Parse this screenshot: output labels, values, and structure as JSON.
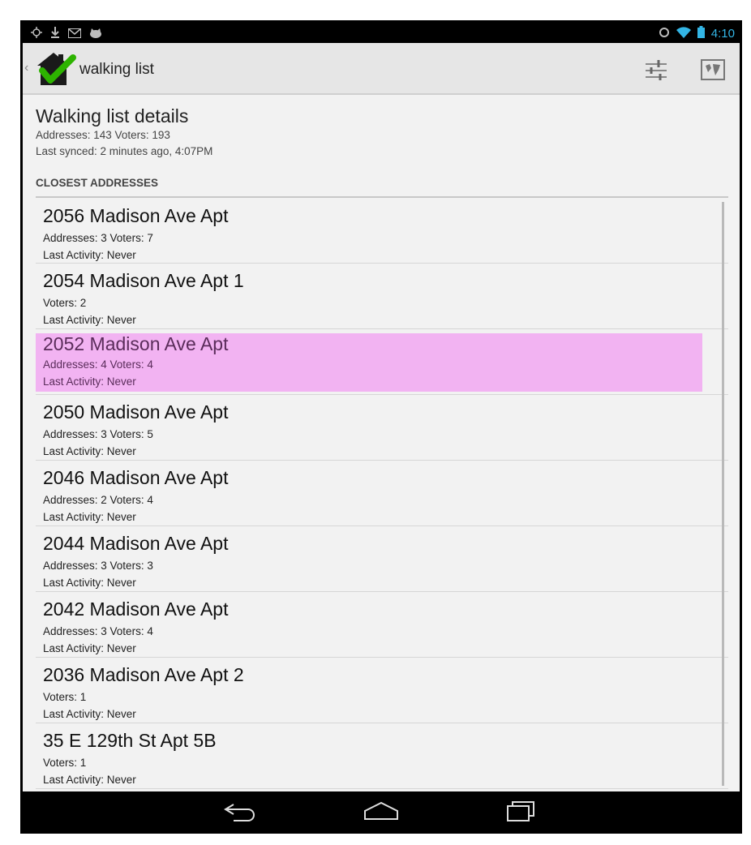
{
  "status_bar": {
    "left_icons": [
      "gps-icon",
      "download-icon",
      "gmail-icon",
      "cat-icon"
    ],
    "right_icons": [
      "sync-icon",
      "wifi-icon",
      "battery-icon"
    ],
    "time": "4:10"
  },
  "action_bar": {
    "title": "walking list",
    "actions": [
      "filter-icon",
      "map-icon"
    ]
  },
  "details": {
    "title": "Walking list details",
    "counts": "Addresses: 143 Voters: 193",
    "synced": "Last synced: 2 minutes ago, 4:07PM"
  },
  "section_header": "CLOSEST ADDRESSES",
  "addresses": [
    {
      "address": "2056 Madison Ave Apt",
      "counts": "Addresses: 3 Voters: 7",
      "activity": "Last Activity: Never",
      "highlighted": false
    },
    {
      "address": "2054 Madison Ave Apt 1",
      "counts": "Voters: 2",
      "activity": "Last Activity: Never",
      "highlighted": false
    },
    {
      "address": "2052 Madison Ave Apt",
      "counts": "Addresses: 4 Voters: 4",
      "activity": "Last Activity: Never",
      "highlighted": true
    },
    {
      "address": "2050 Madison Ave Apt",
      "counts": "Addresses: 3 Voters: 5",
      "activity": "Last Activity: Never",
      "highlighted": false
    },
    {
      "address": "2046 Madison Ave Apt",
      "counts": "Addresses: 2 Voters: 4",
      "activity": "Last Activity: Never",
      "highlighted": false
    },
    {
      "address": "2044 Madison Ave Apt",
      "counts": "Addresses: 3 Voters: 3",
      "activity": "Last Activity: Never",
      "highlighted": false
    },
    {
      "address": "2042 Madison Ave Apt",
      "counts": "Addresses: 3 Voters: 4",
      "activity": "Last Activity: Never",
      "highlighted": false
    },
    {
      "address": "2036 Madison Ave Apt 2",
      "counts": "Voters: 1",
      "activity": "Last Activity: Never",
      "highlighted": false
    },
    {
      "address": "35 E 129th St Apt 5B",
      "counts": "Voters: 1",
      "activity": "Last Activity: Never",
      "highlighted": false
    }
  ],
  "nav_bar": {
    "buttons": [
      "back-icon",
      "home-icon",
      "recents-icon"
    ]
  },
  "colors": {
    "highlight": "#f2b3f2",
    "accent": "#33b5e5",
    "check_green": "#2db300"
  }
}
